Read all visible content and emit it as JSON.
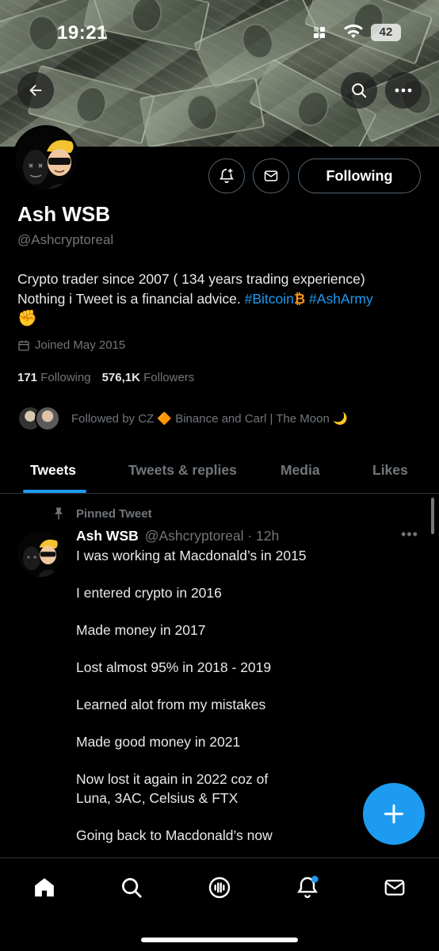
{
  "status_bar": {
    "time": "19:21",
    "battery": "42"
  },
  "banner": {
    "description_icon": "money-banner"
  },
  "header_buttons": {
    "following_label": "Following"
  },
  "profile": {
    "name": "Ash WSB",
    "handle": "@Ashcryptoreal",
    "bio_line1": "Crypto trader since 2007 ( 134 years trading experience)",
    "bio_line2_text": "Nothing i Tweet is a financial advice. ",
    "bio_tag1": "#Bitcoin",
    "bio_emoji1": "₿",
    "bio_tag2": "#AshArmy",
    "bio_emoji2": "✊",
    "joined": "Joined May 2015",
    "following_count": "171",
    "following_label": "Following",
    "followers_count": "576,1K",
    "followers_label": "Followers",
    "followed_by": "Followed by CZ 🔶 Binance and Carl | The Moon 🌙"
  },
  "tabs": [
    {
      "label": "Tweets",
      "active": true
    },
    {
      "label": "Tweets & replies",
      "active": false
    },
    {
      "label": "Media",
      "active": false
    },
    {
      "label": "Likes",
      "active": false
    }
  ],
  "tweet": {
    "pinned_label": "Pinned Tweet",
    "author_name": "Ash WSB",
    "author_meta": "@Ashcryptoreal · 12h",
    "more": "•••",
    "lines": [
      "I was working at Macdonald’s in 2015",
      "I entered crypto in 2016",
      "Made money in 2017",
      "Lost almost 95% in 2018 - 2019",
      "Learned alot from my mistakes",
      "Made good money in 2021",
      "Now lost it again in 2022 coz of",
      "Luna, 3AC, Celsius & FTX",
      "Going back to Macdonald’s now"
    ]
  },
  "colors": {
    "accent": "#1d9bf0",
    "background": "#000000",
    "muted": "#71767b"
  },
  "nav": [
    "home-icon",
    "search-icon",
    "spaces-icon",
    "notifications-icon",
    "messages-icon"
  ]
}
